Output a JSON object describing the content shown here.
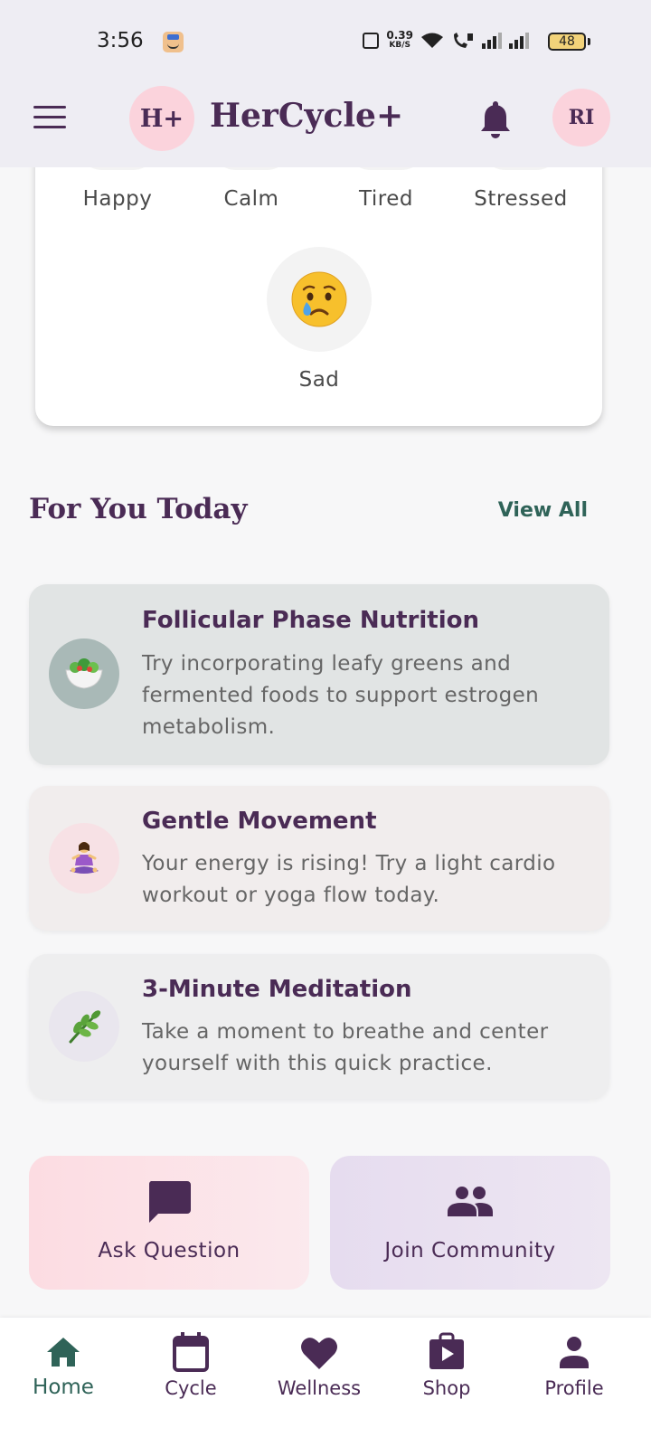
{
  "status_bar": {
    "time": "3:56",
    "net_speed_value": "0.39",
    "net_speed_unit": "KB/S",
    "battery": "48"
  },
  "header": {
    "logo_text": "H+",
    "app_title": "HerCycle+",
    "avatar_initials": "RI"
  },
  "mood": {
    "options": [
      {
        "label": "Happy"
      },
      {
        "label": "Calm"
      },
      {
        "label": "Tired"
      },
      {
        "label": "Stressed"
      }
    ],
    "sad": {
      "label": "Sad",
      "emoji": "😢"
    }
  },
  "for_you": {
    "title": "For You Today",
    "view_all": "View All",
    "cards": [
      {
        "emoji": "🥗",
        "title": "Follicular Phase Nutrition",
        "body_lines": [
          "Try incorporating leafy greens and",
          "fermented foods to support estrogen",
          "metabolism."
        ],
        "bg": "#e1e4e4",
        "icon_bg": "#a9b9b7"
      },
      {
        "emoji": "🧘‍♀️",
        "title": "Gentle Movement",
        "body_lines": [
          "Your energy is rising! Try a light cardio",
          "workout or yoga flow today."
        ],
        "bg": "#f1eded",
        "icon_bg": "#f7e1e5"
      },
      {
        "emoji": "🌿",
        "title": "3-Minute Meditation",
        "body_lines": [
          "Take a moment to breathe and center",
          "yourself with this quick practice."
        ],
        "bg": "#eeeeef",
        "icon_bg": "#e9e6ee"
      }
    ]
  },
  "actions": {
    "ask": {
      "label": "Ask Question",
      "icon": "chat-bubble-icon",
      "bg": "#fcdce2"
    },
    "community": {
      "label": "Join Community",
      "icon": "people-icon",
      "bg": "#e6dcef"
    }
  },
  "bottom_nav": {
    "items": [
      {
        "label": "Home",
        "icon": "home-icon"
      },
      {
        "label": "Cycle",
        "icon": "calendar-icon"
      },
      {
        "label": "Wellness",
        "icon": "heart-icon"
      },
      {
        "label": "Shop",
        "icon": "shop-bag-icon"
      },
      {
        "label": "Profile",
        "icon": "person-icon"
      }
    ],
    "active_color": "#2f6358",
    "inactive_color": "#4a2b55"
  }
}
